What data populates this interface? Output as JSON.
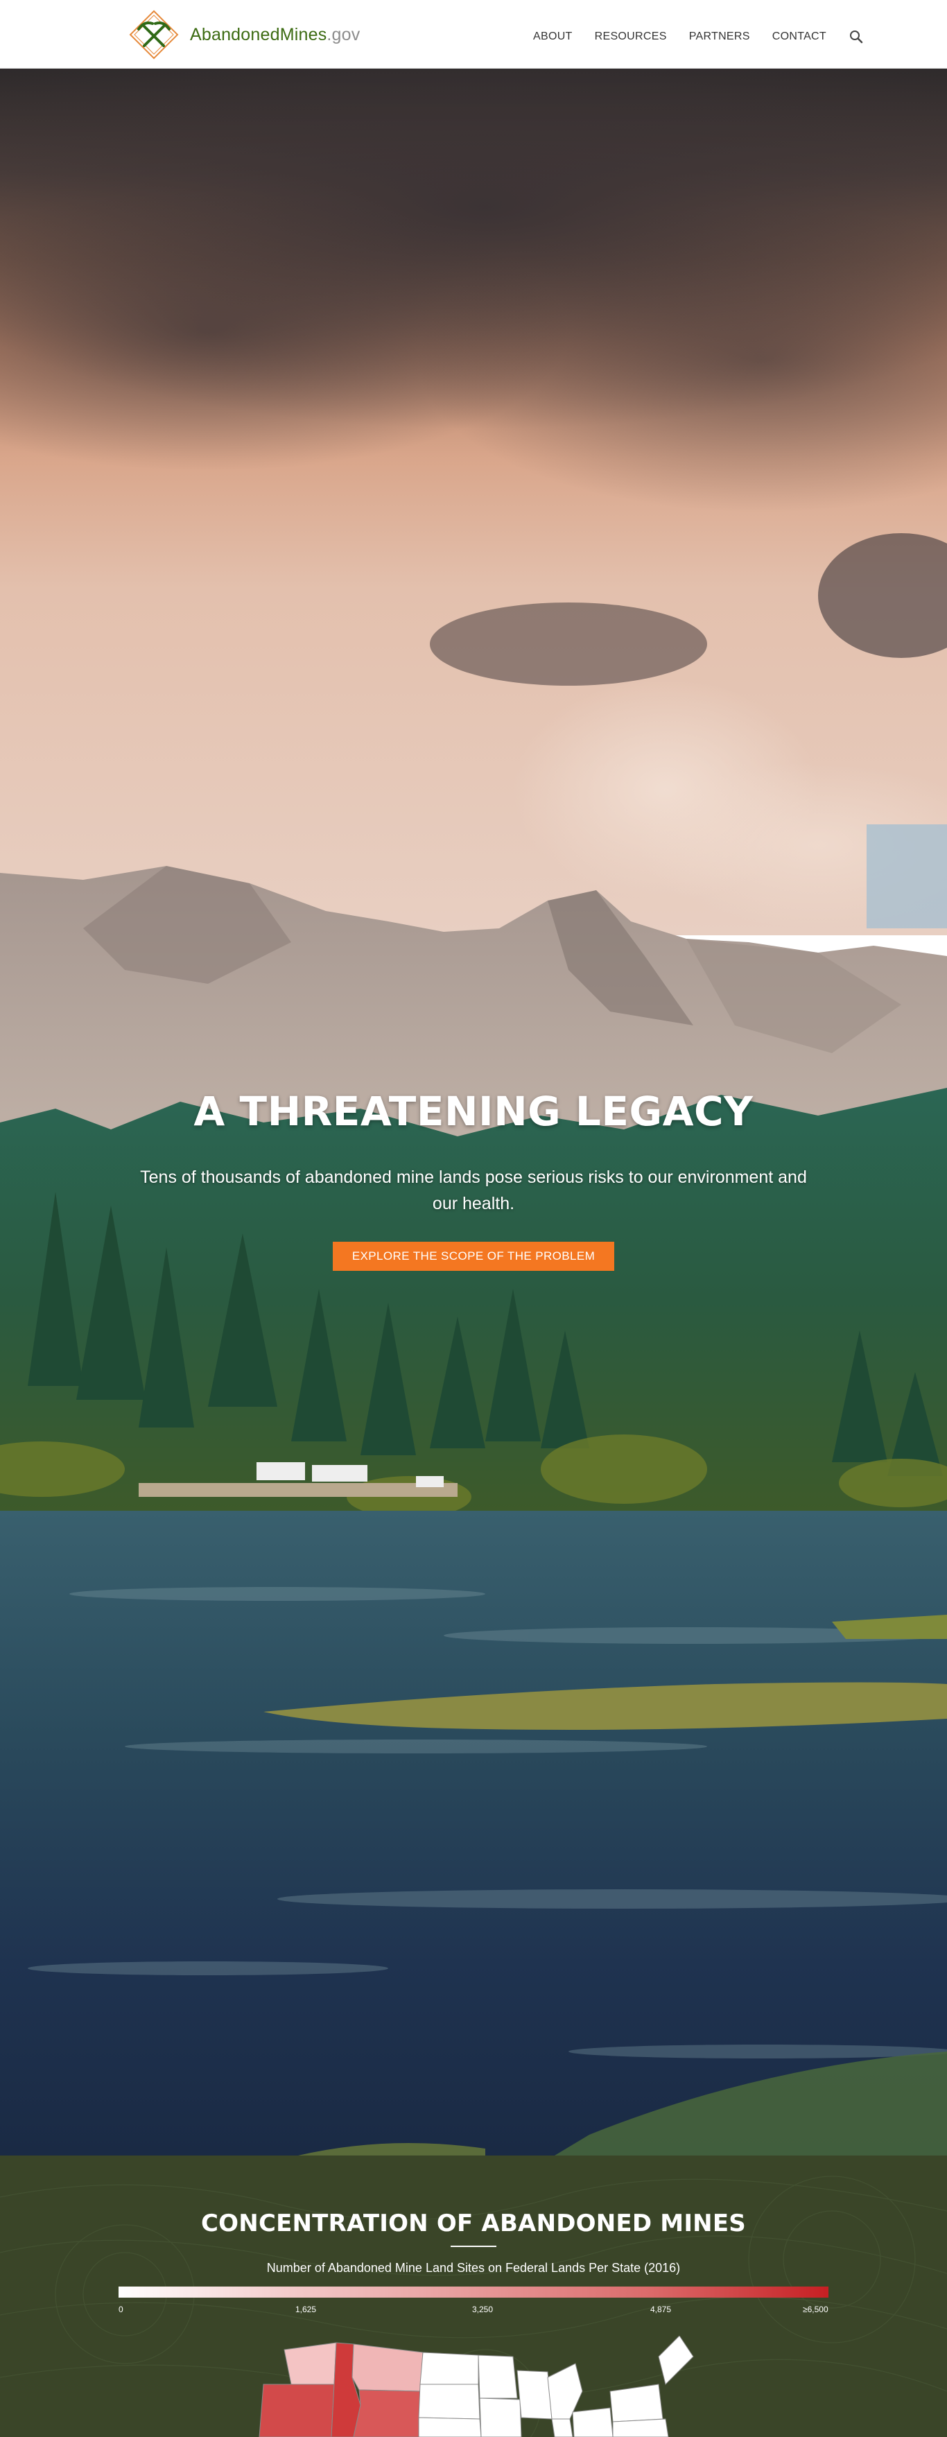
{
  "header": {
    "logo_name": "AbandonedMines",
    "logo_tld": ".gov",
    "nav": [
      "ABOUT",
      "RESOURCES",
      "PARTNERS",
      "CONTACT"
    ],
    "search_icon": "search-icon"
  },
  "hero": {
    "title": "A THREATENING LEGACY",
    "subtitle": "Tens of thousands of abandoned mine lands pose serious risks to our environment and our health.",
    "cta_label": "EXPLORE THE SCOPE OF THE PROBLEM",
    "cta_color": "#f47721",
    "scroll_icon": "chevron-down-icon"
  },
  "concentration": {
    "title": "CONCENTRATION OF ABANDONED MINES",
    "subtitle": "Number of Abandoned Mine Land Sites on Federal Lands Per State (2016)",
    "legend_ticks": [
      "0",
      "1,625",
      "3,250",
      "4,875",
      "≥6,500"
    ],
    "legend_low_color": "#ffffff",
    "legend_high_color": "#c61f23",
    "background_color": "#3a4528"
  }
}
